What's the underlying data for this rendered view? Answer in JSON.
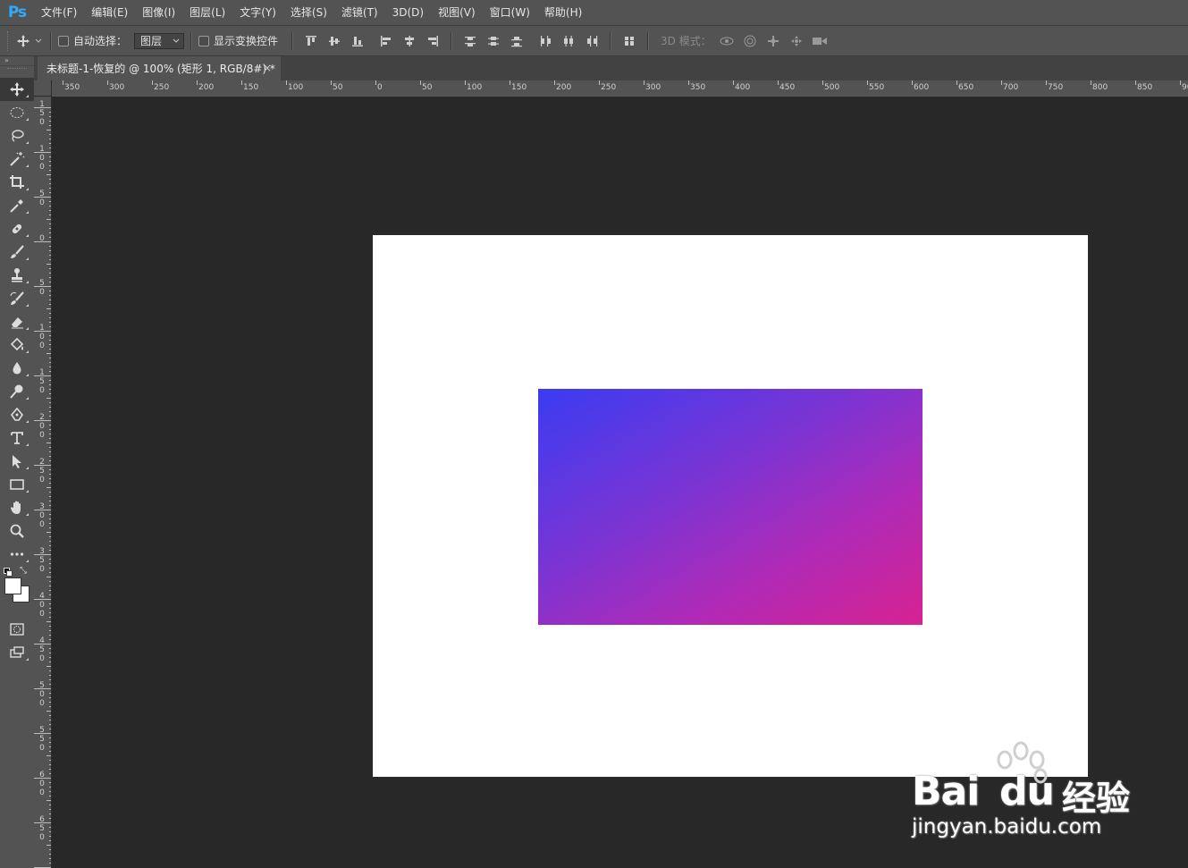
{
  "app": {
    "logo": "Ps"
  },
  "menu": [
    "文件(F)",
    "编辑(E)",
    "图像(I)",
    "图层(L)",
    "文字(Y)",
    "选择(S)",
    "滤镜(T)",
    "3D(D)",
    "视图(V)",
    "窗口(W)",
    "帮助(H)"
  ],
  "options": {
    "auto_select_label": "自动选择：",
    "auto_select_value": "图层",
    "show_transform_label": "显示变换控件",
    "mode_3d_label": "3D 模式："
  },
  "document_tab": {
    "title": "未标题-1-恢复的 @ 100% (矩形 1, RGB/8#) *",
    "close": "×"
  },
  "rulers": {
    "top": [
      "350",
      "300",
      "250",
      "200",
      "150",
      "100",
      "50",
      "0",
      "50",
      "100",
      "150",
      "200",
      "250",
      "300",
      "350",
      "400",
      "450",
      "500",
      "550",
      "600",
      "650",
      "700",
      "750",
      "800",
      "850",
      "90"
    ],
    "left": [
      "150",
      "100",
      "50",
      "0",
      "50",
      "100",
      "150",
      "200",
      "250",
      "300",
      "350",
      "400",
      "450",
      "500",
      "550",
      "600",
      "650"
    ]
  },
  "canvas": {
    "background": "#ffffff",
    "shape_gradient": [
      "#3a3cf2",
      "#7a34d4",
      "#b12ab6",
      "#d72291"
    ]
  },
  "watermark": {
    "brand": "Bai",
    "brand2": "du",
    "cn": "经验",
    "url": "jingyan.baidu.com"
  }
}
